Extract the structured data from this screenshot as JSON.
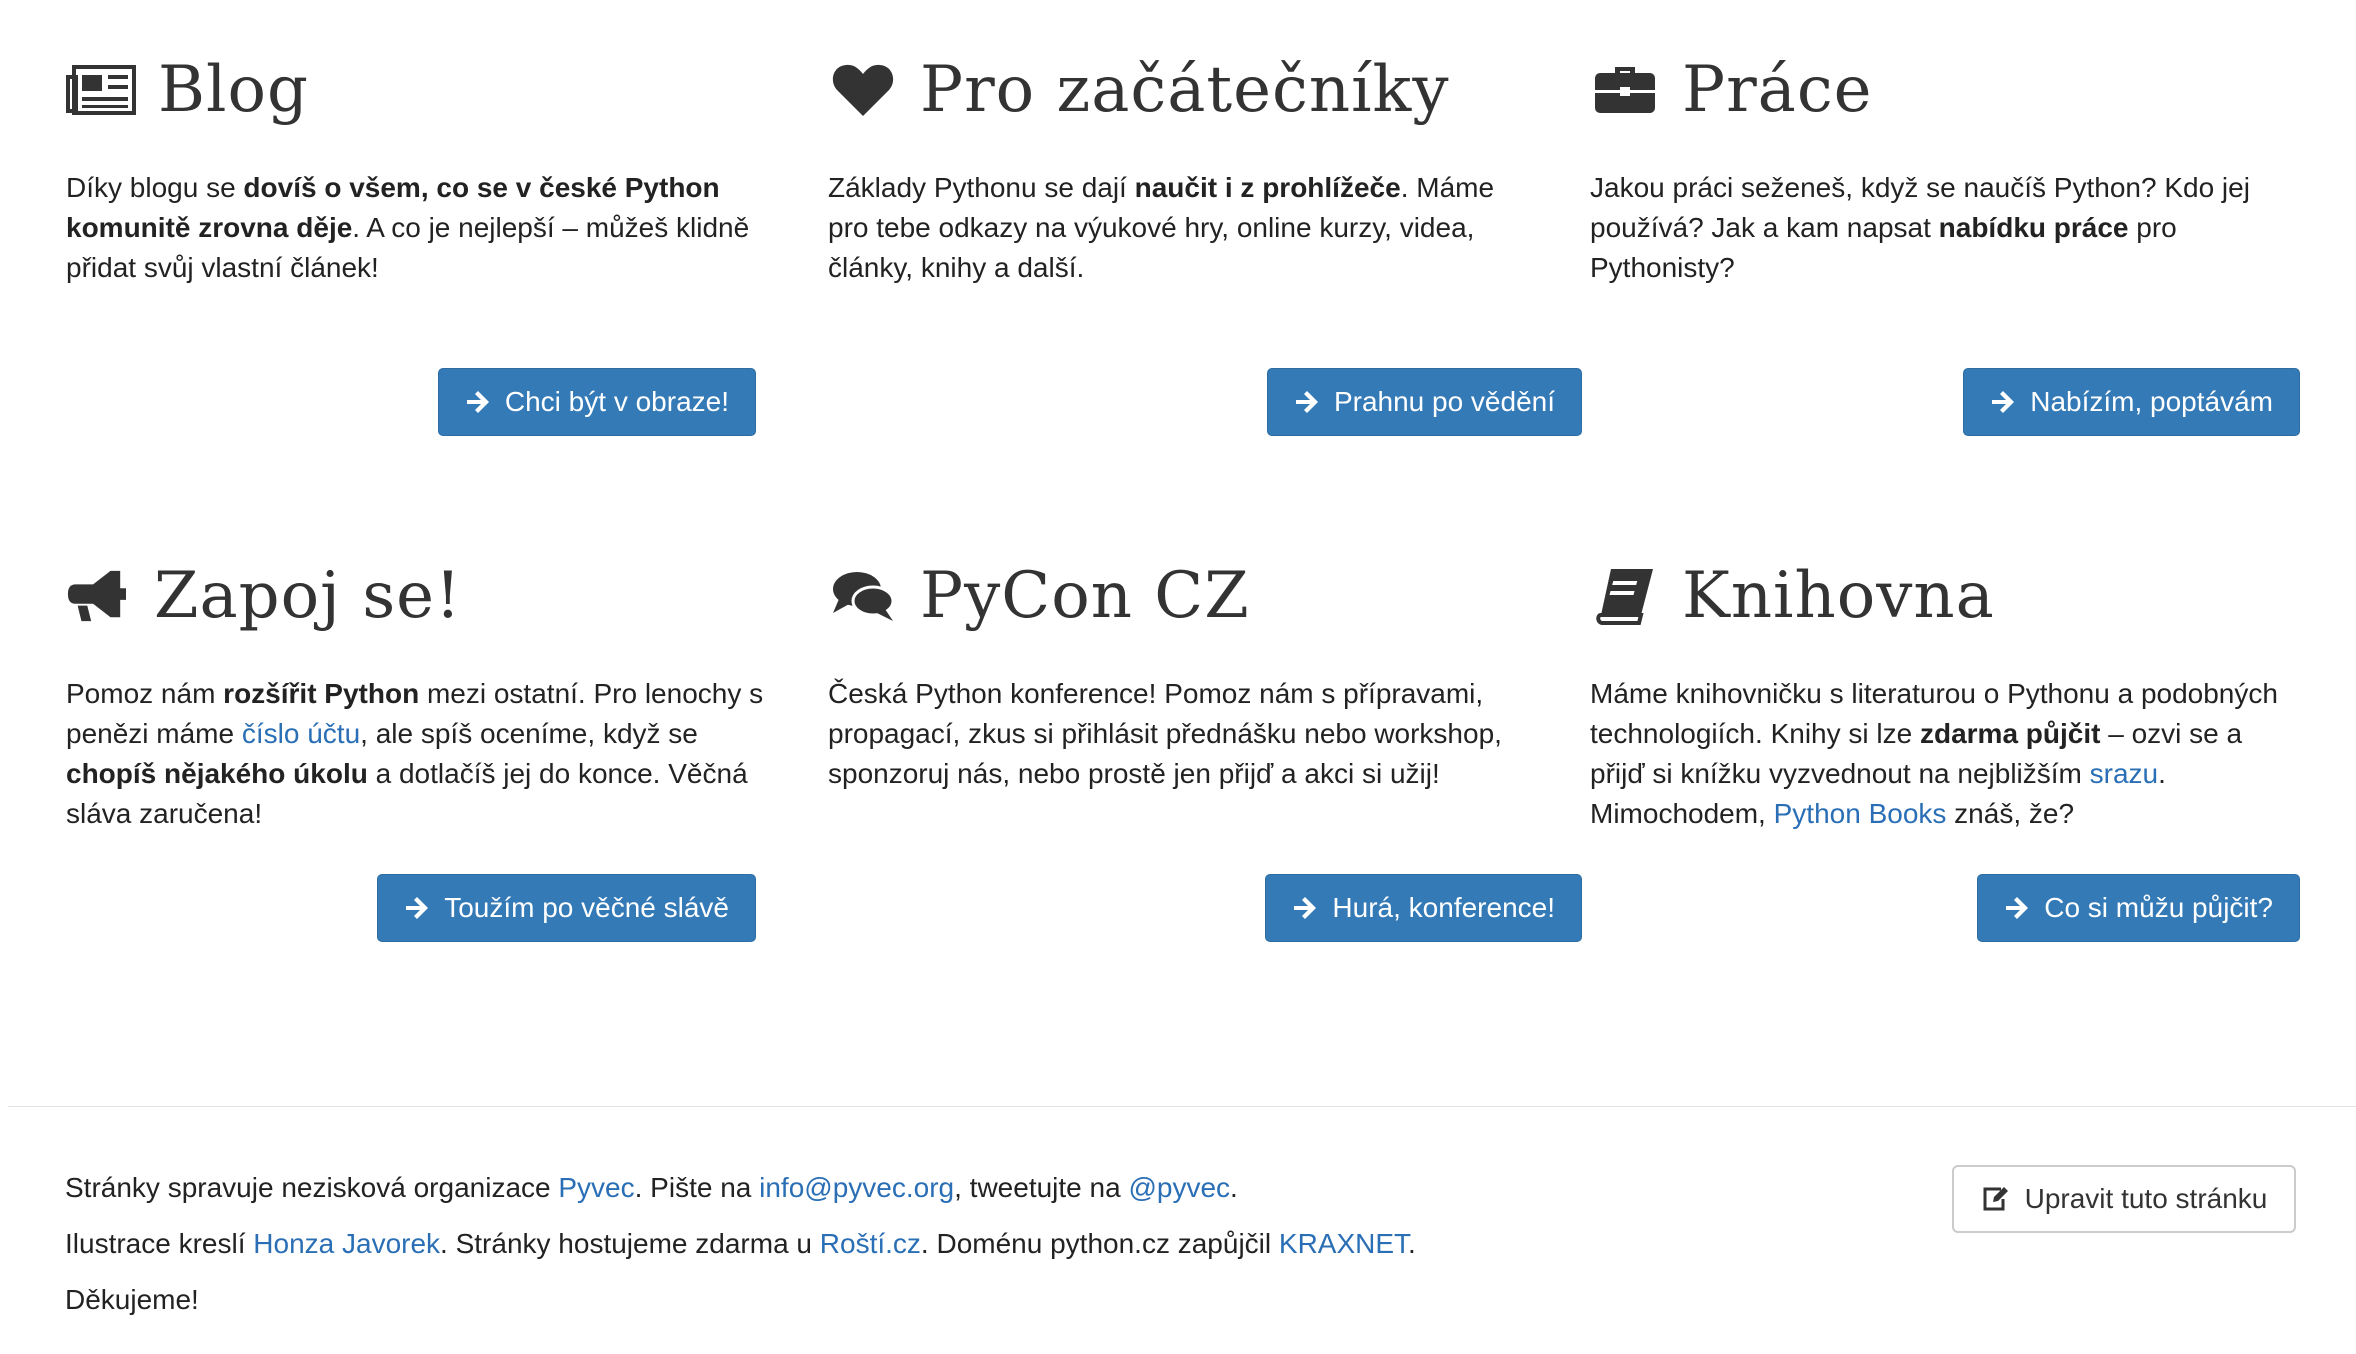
{
  "cards": [
    {
      "title": "Blog",
      "icon": "newspaper-icon",
      "text": [
        {
          "t": "Díky blogu se ",
          "b": false
        },
        {
          "t": "dovíš o všem, co se v české Python komunitě zrovna děje",
          "b": true
        },
        {
          "t": ". A co je nejlepší – můžeš klidně přidat svůj vlastní článek!",
          "b": false
        }
      ],
      "button": "Chci být v obraze!"
    },
    {
      "title": "Pro začátečníky",
      "icon": "heart-icon",
      "text": [
        {
          "t": "Základy Pythonu se dají ",
          "b": false
        },
        {
          "t": "naučit i z prohlížeče",
          "b": true
        },
        {
          "t": ". Máme pro tebe odkazy na výukové hry, online kurzy, videa, články, knihy a další.",
          "b": false
        }
      ],
      "button": "Prahnu po vědění"
    },
    {
      "title": "Práce",
      "icon": "briefcase-icon",
      "text": [
        {
          "t": "Jakou práci seženeš, když se naučíš Python? Kdo jej používá? Jak a kam napsat ",
          "b": false
        },
        {
          "t": "nabídku práce",
          "b": true
        },
        {
          "t": " pro Pythonisty?",
          "b": false
        }
      ],
      "button": "Nabízím, poptávám"
    },
    {
      "title": "Zapoj se!",
      "icon": "megaphone-icon",
      "text": [
        {
          "t": "Pomoz nám ",
          "b": false
        },
        {
          "t": "rozšířit Python",
          "b": true
        },
        {
          "t": " mezi ostatní. Pro lenochy s penězi máme ",
          "b": false
        },
        {
          "t": "číslo účtu",
          "link": true
        },
        {
          "t": ", ale spíš oceníme, když se ",
          "b": false
        },
        {
          "t": "chopíš nějakého úkolu",
          "b": true
        },
        {
          "t": " a dotlačíš jej do konce. Věčná sláva zaručena!",
          "b": false
        }
      ],
      "button": "Toužím po věčné slávě"
    },
    {
      "title": "PyCon CZ",
      "icon": "comments-icon",
      "text": [
        {
          "t": "Česká Python konference! Pomoz nám s přípravami, propagací, zkus si přihlásit přednášku nebo workshop, sponzoruj nás, nebo prostě jen přijď a akci si užij!",
          "b": false
        }
      ],
      "button": "Hurá, konference!"
    },
    {
      "title": "Knihovna",
      "icon": "book-icon",
      "text": [
        {
          "t": "Máme knihovničku s literaturou o Pythonu a podobných technologiích. Knihy si lze ",
          "b": false
        },
        {
          "t": "zdarma půjčit",
          "b": true
        },
        {
          "t": " – ozvi se a přijď si knížku vyzvednout na nejbližším ",
          "b": false
        },
        {
          "t": "srazu",
          "link": true
        },
        {
          "t": ". Mimochodem, ",
          "b": false
        },
        {
          "t": "Python Books",
          "link": true
        },
        {
          "t": " znáš, že?",
          "b": false
        }
      ],
      "button": "Co si můžu půjčit?"
    }
  ],
  "footer": {
    "lines": [
      [
        {
          "t": "Stránky spravuje nezisková organizace "
        },
        {
          "t": "Pyvec",
          "link": true
        },
        {
          "t": ". Pište na "
        },
        {
          "t": "info@pyvec.org",
          "link": true
        },
        {
          "t": ", tweetujte na "
        },
        {
          "t": "@pyvec",
          "link": true
        },
        {
          "t": "."
        }
      ],
      [
        {
          "t": "Ilustrace kreslí "
        },
        {
          "t": "Honza Javorek",
          "link": true
        },
        {
          "t": ". Stránky hostujeme zdarma u "
        },
        {
          "t": "Roští.cz",
          "link": true
        },
        {
          "t": ". Doménu python.cz zapůjčil "
        },
        {
          "t": "KRAXNET",
          "link": true
        },
        {
          "t": "."
        }
      ],
      [
        {
          "t": "Děkujeme!"
        }
      ]
    ],
    "edit_button": "Upravit tuto stránku"
  },
  "colors": {
    "primary": "#337ab7",
    "link": "#2a6fb5",
    "icon": "#333333"
  }
}
